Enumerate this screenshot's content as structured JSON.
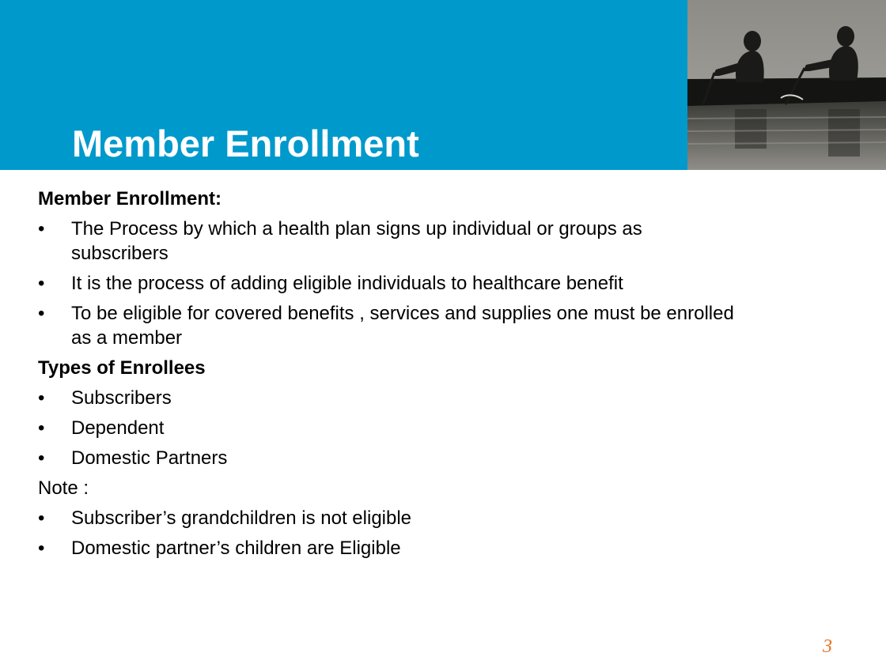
{
  "slide": {
    "title": "Member Enrollment",
    "page_number": "3"
  },
  "colors": {
    "header_band": "#0099cc",
    "title_text": "#ffffff",
    "body_text": "#000000",
    "page_number": "#e8711c"
  },
  "icons": {
    "header_image": "rowers-silhouette-photo"
  },
  "content": {
    "section1": {
      "heading": "Member Enrollment:",
      "bullet_glyph": "•",
      "items": [
        "The Process by which a health plan signs up individual or groups as subscribers",
        "It is the process of adding eligible individuals to healthcare benefit",
        "To be eligible for covered benefits , services and supplies one must be enrolled as a member"
      ]
    },
    "section2": {
      "heading": "Types of Enrollees",
      "items": [
        "Subscribers",
        "Dependent",
        "Domestic Partners"
      ]
    },
    "section3": {
      "heading": "Note :",
      "items": [
        "Subscriber’s grandchildren is not eligible",
        "Domestic partner’s children are Eligible"
      ]
    }
  }
}
